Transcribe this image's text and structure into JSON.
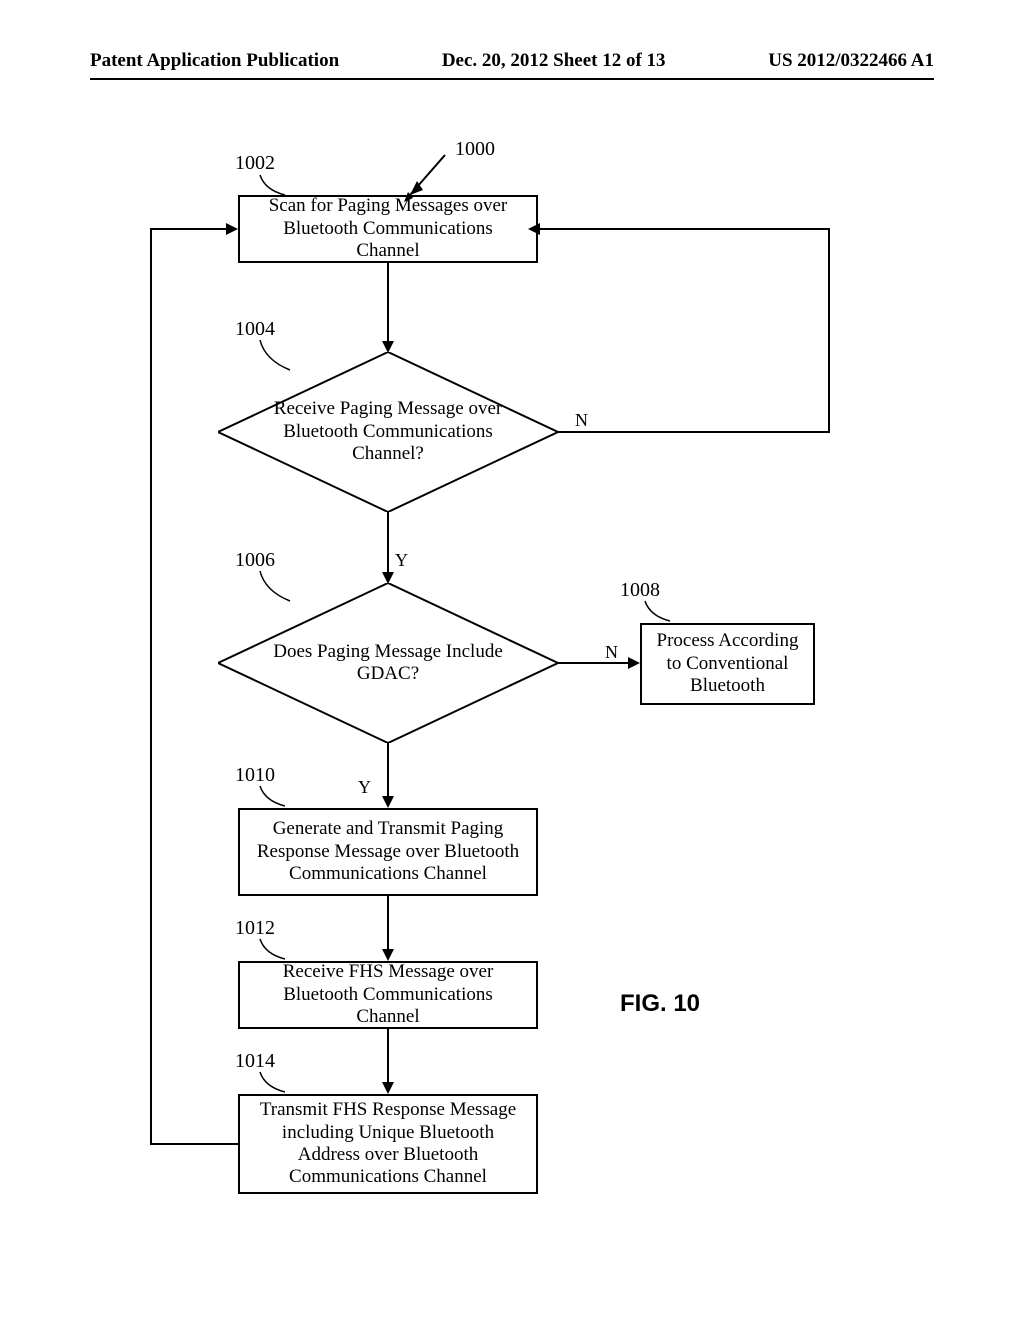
{
  "header": {
    "left": "Patent Application Publication",
    "center": "Dec. 20, 2012  Sheet 12 of 13",
    "right": "US 2012/0322466 A1"
  },
  "refs": {
    "r1000": "1000",
    "r1002": "1002",
    "r1004": "1004",
    "r1006": "1006",
    "r1008": "1008",
    "r1010": "1010",
    "r1012": "1012",
    "r1014": "1014"
  },
  "boxes": {
    "b1002": "Scan for Paging Messages over Bluetooth Communications Channel",
    "b1004": "Receive Paging Message over Bluetooth Communications Channel?",
    "b1006": "Does Paging Message Include GDAC?",
    "b1008": "Process According to Conventional Bluetooth",
    "b1010": "Generate and Transmit Paging Response Message over Bluetooth Communications Channel",
    "b1012": "Receive FHS Message over Bluetooth Communications Channel",
    "b1014": "Transmit FHS Response Message including Unique Bluetooth Address over Bluetooth Communications Channel"
  },
  "labels": {
    "y": "Y",
    "n": "N"
  },
  "figure": "FIG. 10"
}
